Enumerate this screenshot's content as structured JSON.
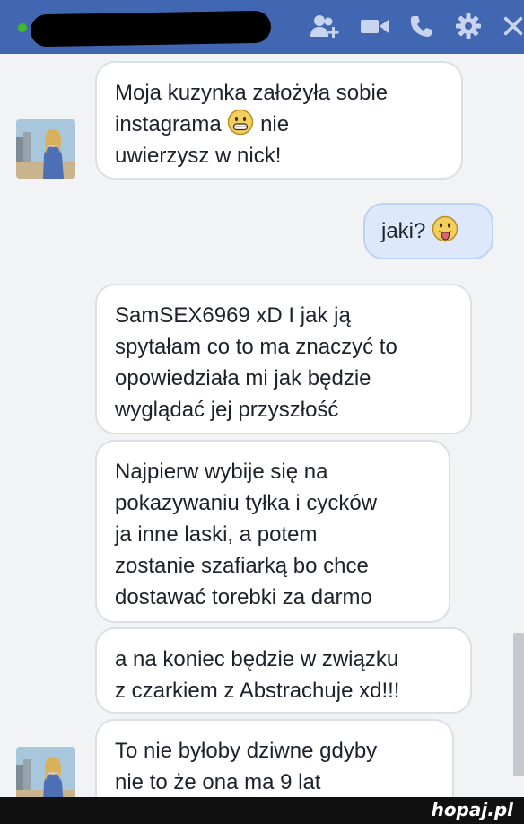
{
  "header": {
    "name": "",
    "icons": [
      "add-person-icon",
      "video-call-icon",
      "phone-icon",
      "gear-icon",
      "close-icon"
    ],
    "colors": {
      "bar": "#4267b2",
      "online": "#42b72a"
    }
  },
  "messages": [
    {
      "side": "left",
      "lines": [
        "Moja kuzynka założyła sobie",
        "instagrama",
        "uwierzysz w nick!"
      ],
      "emoji": "grin-emoji"
    },
    {
      "side": "right",
      "lines": [
        "jaki?"
      ],
      "emoji": "tongue-emoji"
    },
    {
      "side": "left",
      "lines": [
        "SamSEX6969 xD I jak ją",
        "spytałam co to ma znaczyć to",
        "opowiedziała mi jak będzie",
        "wyglądać jej przyszłość"
      ]
    },
    {
      "side": "left",
      "lines": [
        "Najpierw wybije się na",
        "pokazywaniu tyłka i cycków",
        "ja inne laski, a potem",
        "zostanie szafiarką bo chce",
        "dostawać torebki za darmo"
      ]
    },
    {
      "side": "left",
      "lines": [
        "a na koniec będzie w związku",
        "z czarkiem z Abstrachuje xd!!!"
      ]
    },
    {
      "side": "left",
      "lines": [
        "To nie byłoby dziwne gdyby",
        "nie to że ona ma 9 lat"
      ]
    }
  ],
  "inline_text": {
    "after_emoji": "nie"
  },
  "footer": {
    "watermark": "hopaj.pl"
  }
}
